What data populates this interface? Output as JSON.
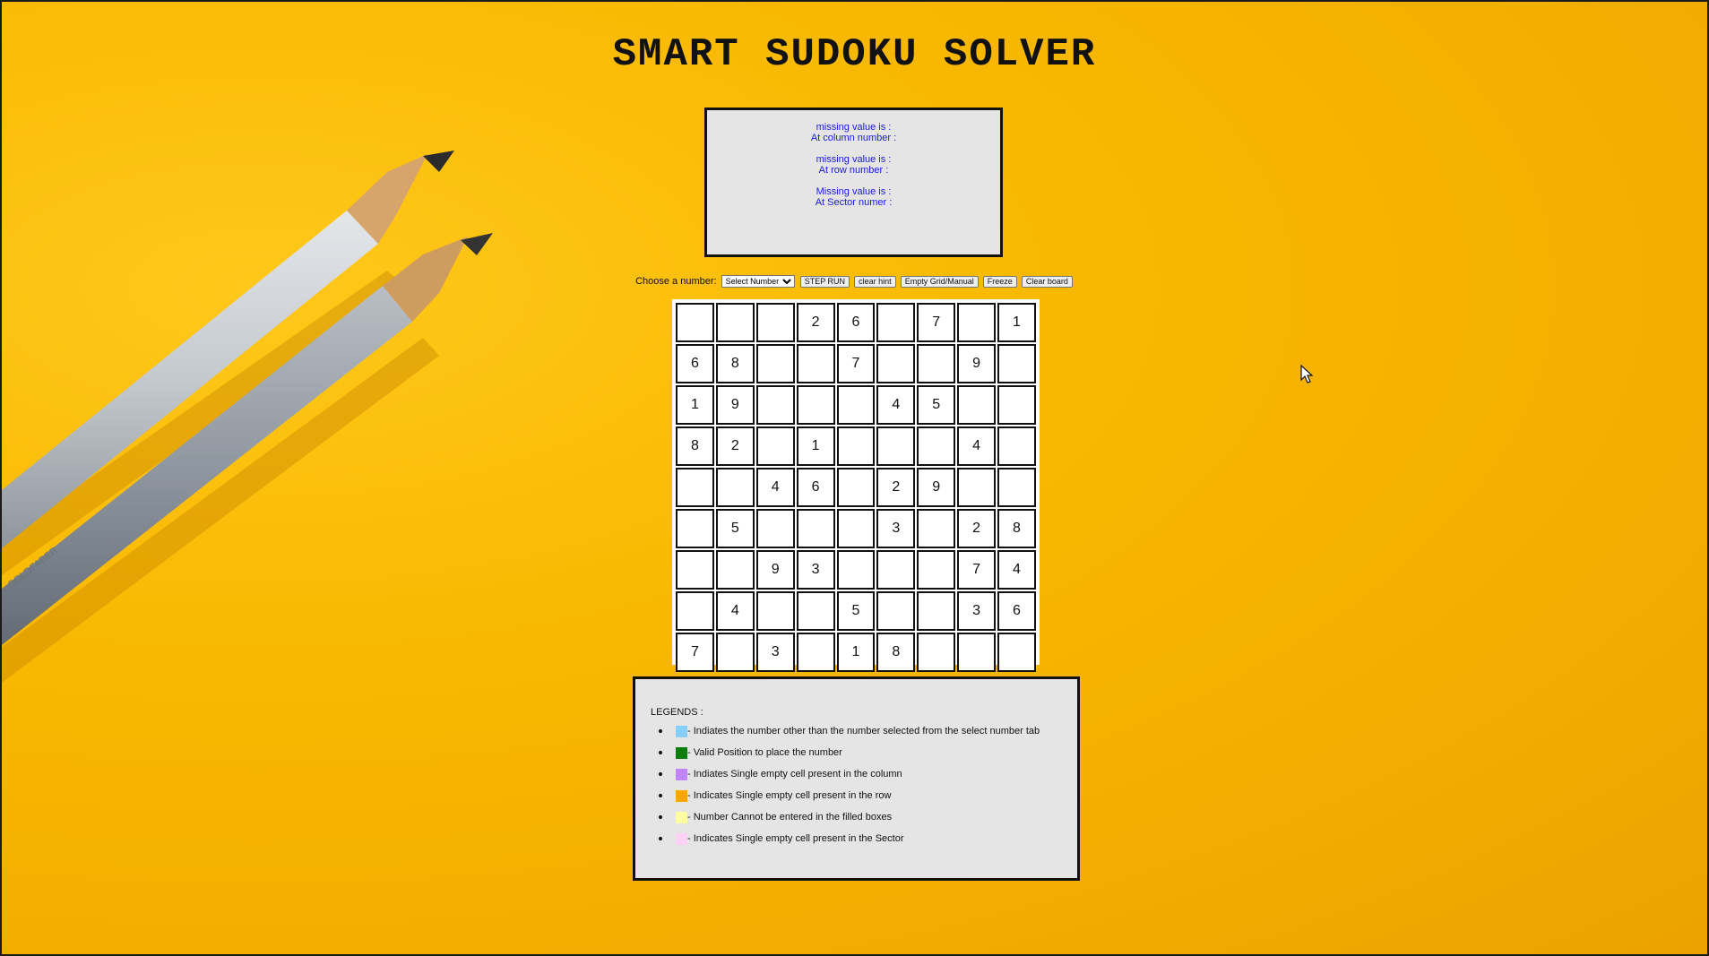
{
  "title": "SMART SUDOKU SOLVER",
  "hints": {
    "column": [
      "missing value is :",
      "At column number :"
    ],
    "row": [
      "missing value is :",
      "At row number :"
    ],
    "sector": [
      "Missing value is :",
      "At Sector numer :"
    ]
  },
  "controls": {
    "choose_label": "Choose a number:",
    "select_placeholder": "Select Number",
    "buttons": [
      "STEP RUN",
      "clear hint",
      "Empty Grid/Manual",
      "Freeze",
      "Clear board"
    ]
  },
  "grid": [
    [
      "",
      "",
      "",
      "2",
      "6",
      "",
      "7",
      "",
      "1"
    ],
    [
      "6",
      "8",
      "",
      "",
      "7",
      "",
      "",
      "9",
      ""
    ],
    [
      "1",
      "9",
      "",
      "",
      "",
      "4",
      "5",
      "",
      ""
    ],
    [
      "8",
      "2",
      "",
      "1",
      "",
      "",
      "",
      "4",
      ""
    ],
    [
      "",
      "",
      "4",
      "6",
      "",
      "2",
      "9",
      "",
      ""
    ],
    [
      "",
      "5",
      "",
      "",
      "",
      "3",
      "",
      "2",
      "8"
    ],
    [
      "",
      "",
      "9",
      "3",
      "",
      "",
      "",
      "7",
      "4"
    ],
    [
      "",
      "4",
      "",
      "",
      "5",
      "",
      "",
      "3",
      "6"
    ],
    [
      "7",
      "",
      "3",
      "",
      "1",
      "8",
      "",
      "",
      ""
    ]
  ],
  "legend": {
    "title": "LEGENDS :",
    "items": [
      {
        "color": "#87cefa",
        "text": "- Indiates the number other than the number selected from the select number tab"
      },
      {
        "color": "#0a7d0a",
        "text": "- Valid Position to place the number"
      },
      {
        "color": "#c084fc",
        "text": "- Indiates Single empty cell present in the column"
      },
      {
        "color": "#ffa500",
        "text": "- Indicates Single empty cell present in the row"
      },
      {
        "color": "#ffffa0",
        "text": "- Number Cannot be entered in the filled boxes"
      },
      {
        "color": "#ffd1f5",
        "text": "- Indicates Single empty cell present in the Sector"
      }
    ]
  }
}
